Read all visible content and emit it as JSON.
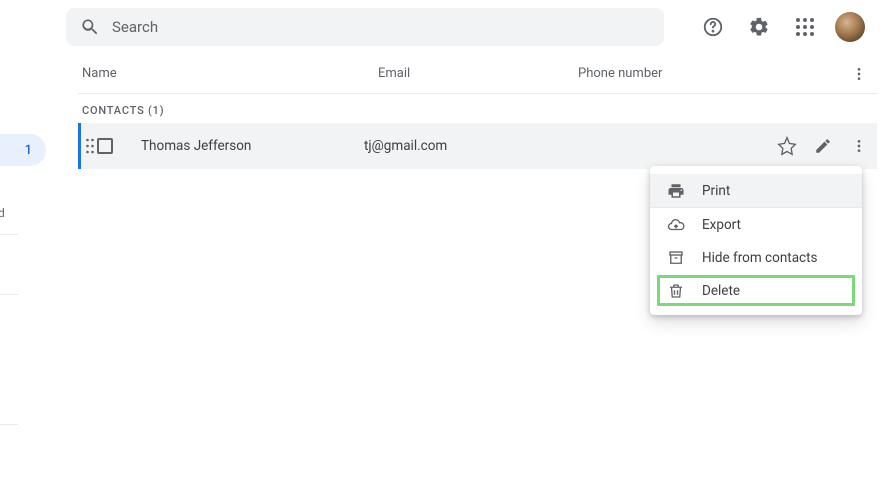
{
  "search": {
    "placeholder": "Search"
  },
  "sidebar": {
    "badge_count": "1",
    "fragment": "d"
  },
  "columns": {
    "name": "Name",
    "email": "Email",
    "phone": "Phone number"
  },
  "section": {
    "label": "CONTACTS (1)"
  },
  "contacts": [
    {
      "name": "Thomas Jefferson",
      "email": "tj@gmail.com",
      "phone": ""
    }
  ],
  "menu": {
    "print": "Print",
    "export": "Export",
    "hide": "Hide from contacts",
    "delete": "Delete"
  }
}
